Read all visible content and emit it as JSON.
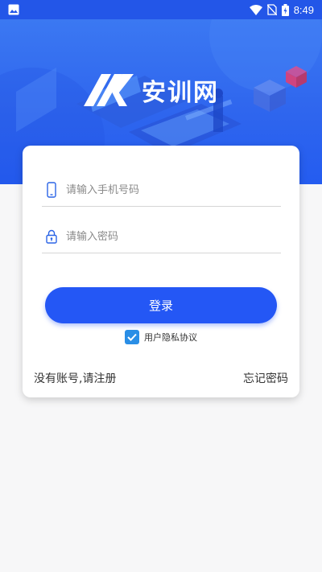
{
  "status_bar": {
    "time": "8:49",
    "icons": [
      "gallery-icon",
      "wifi-icon",
      "no-sim-icon",
      "battery-charging-icon"
    ]
  },
  "header": {
    "brand_text": "安训网",
    "logo_icon": "logo-mark-icon"
  },
  "form": {
    "phone": {
      "placeholder": "请输入手机号码",
      "value": "",
      "icon": "phone-icon"
    },
    "password": {
      "placeholder": "请输入密码",
      "value": "",
      "icon": "lock-icon"
    },
    "login_label": "登录",
    "agreement": {
      "checked": true,
      "label": "用户隐私协议"
    },
    "register_link": "没有账号,请注册",
    "forgot_link": "忘记密码"
  },
  "colors": {
    "primary": "#2457f5",
    "header_top": "#3b78f2",
    "header_bottom": "#245cf0",
    "checkbox": "#2a8ee6",
    "page_bg": "#f7f7f8"
  }
}
